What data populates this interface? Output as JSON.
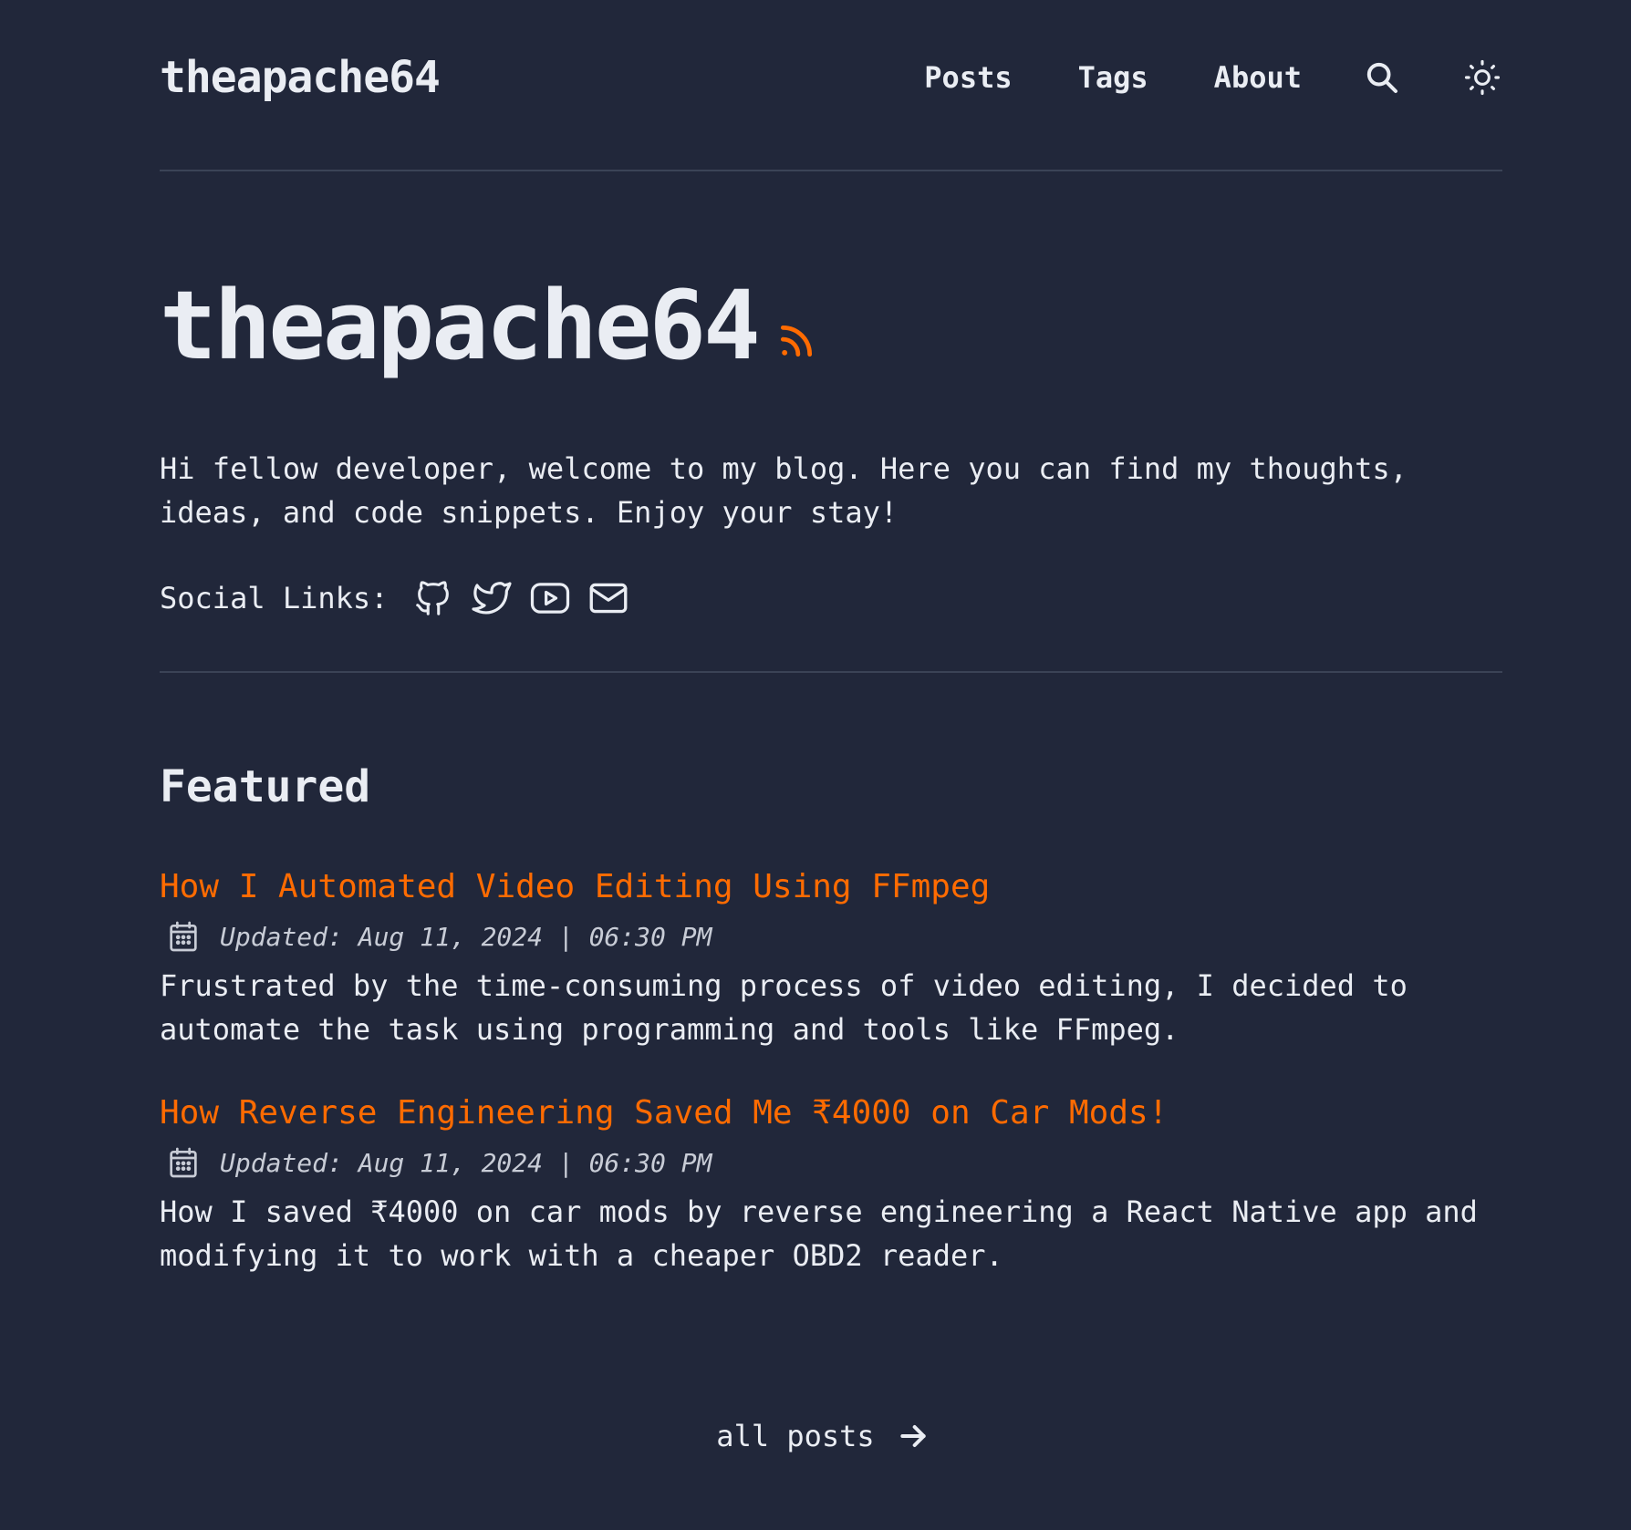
{
  "header": {
    "site_title": "theapache64",
    "nav": [
      {
        "label": "Posts"
      },
      {
        "label": "Tags"
      },
      {
        "label": "About"
      }
    ],
    "icons": [
      "search-icon",
      "sun-icon"
    ]
  },
  "hero": {
    "title": "theapache64",
    "intro_line1": "Hi fellow developer, welcome to my blog. Here you can find my thoughts,",
    "intro_line2": "ideas, and code snippets. Enjoy your stay!",
    "social_label": "Social Links:",
    "social_icons": [
      "github-icon",
      "twitter-icon",
      "youtube-icon",
      "mail-icon"
    ]
  },
  "featured": {
    "heading": "Featured",
    "posts": [
      {
        "title": "How I Automated Video Editing Using FFmpeg",
        "meta": "Updated: Aug 11, 2024 | 06:30 PM",
        "desc_line1": "Frustrated by the time-consuming process of video editing, I decided to",
        "desc_line2": "automate the task using programming and tools like FFmpeg."
      },
      {
        "title": "How Reverse Engineering Saved Me ₹4000 on Car Mods!",
        "meta": "Updated: Aug 11, 2024 | 06:30 PM",
        "desc_line1": "How I saved ₹4000 on car mods by reverse engineering a React Native app and",
        "desc_line2": "modifying it to work with a cheaper OBD2 reader."
      }
    ]
  },
  "footer": {
    "all_posts_label": "all posts"
  },
  "colors": {
    "background": "#21273a",
    "text": "#eaedf3",
    "accent": "#ff6b01",
    "border": "#3b4356"
  }
}
